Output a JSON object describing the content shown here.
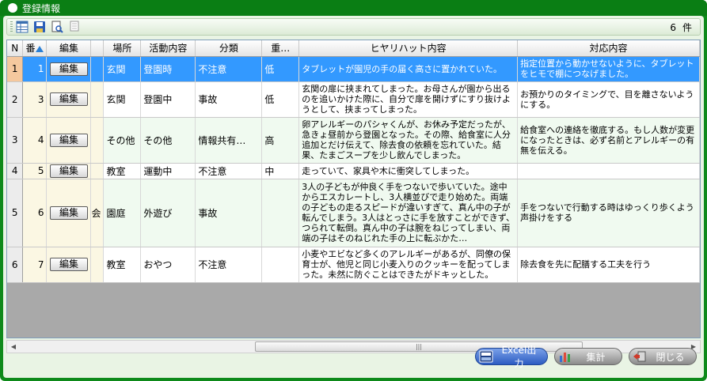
{
  "window": {
    "title": "登録情報"
  },
  "toolbar": {
    "icons": [
      "grid-icon",
      "save-icon",
      "preview-icon",
      "print-icon"
    ],
    "count": "6",
    "count_unit": "件"
  },
  "table": {
    "headers": {
      "rownum": "N",
      "ban": "番",
      "edit": "編集",
      "blank": "",
      "place": "場所",
      "activity": "活動内容",
      "category": "分類",
      "severity": "重…",
      "incident": "ヒヤリハット内容",
      "response": "対応内容"
    },
    "edit_label": "編集",
    "rows": [
      {
        "rownum": "1",
        "ban": "1",
        "extra": "",
        "place": "玄関",
        "activity": "登園時",
        "category": "不注意",
        "severity": "低",
        "incident": "タブレットが園児の手の届く高さに置かれていた。",
        "response": "指定位置から動かせないように、タブレットをヒモで棚につなげました。"
      },
      {
        "rownum": "2",
        "ban": "3",
        "extra": "",
        "place": "玄関",
        "activity": "登園中",
        "category": "事故",
        "severity": "低",
        "incident": "玄関の扉に挟まれてしまった。お母さんが園から出るのを追いかけた際に、自分で扉を開けずにすり抜けようとして、挟まってしまった。",
        "response": "お預かりのタイミングで、目を離さないようにする。"
      },
      {
        "rownum": "3",
        "ban": "4",
        "extra": "",
        "place": "その他",
        "activity": "その他",
        "category": "情報共有…",
        "severity": "高",
        "incident": "卵アレルギーのパシャくんが、お休み予定だったが、急きょ昼前から登園となった。その際、給食室に人分追加とだけ伝えて、除去食の依頼を忘れていた。結果、たまごスープを少し飲んでしまった。",
        "response": "給食室への連絡を徹底する。もし人数が変更になったときは、必ず名前とアレルギーの有無を伝える。"
      },
      {
        "rownum": "4",
        "ban": "5",
        "extra": "",
        "place": "教室",
        "activity": "運動中",
        "category": "不注意",
        "severity": "中",
        "incident": "走っていて、家具や木に衝突してしまった。",
        "response": ""
      },
      {
        "rownum": "5",
        "ban": "6",
        "extra": "会",
        "place": "園庭",
        "activity": "外遊び",
        "category": "事故",
        "severity": "",
        "incident": "3人の子どもが仲良く手をつないで歩いていた。途中からエスカレートし、3人横並びで走り始めた。両端の子どもの走るスピードが違いすぎて、真ん中の子が転んでしまう。3人はとっさに手を放すことができず、つられて転倒。真ん中の子は腕をねじってしまい、両端の子はそのねじれた手の上に転ぶかた…",
        "response": "手をつないで行動する時はゆっくり歩くよう声掛けをする"
      },
      {
        "rownum": "6",
        "ban": "7",
        "extra": "",
        "place": "教室",
        "activity": "おやつ",
        "category": "不注意",
        "severity": "",
        "incident": "小麦やエビなど多くのアレルギーがあるが、同僚の保育士が、他児と同じ小麦入りのクッキーを配ってしまった。未然に防ぐことはできたがドキッとした。",
        "response": "除去食を先に配膳する工夫を行う"
      }
    ]
  },
  "footer": {
    "excel_label": "Excel出力",
    "sum_label": "集計",
    "close_label": "閉じる"
  },
  "colors": {
    "frame": "#0e8a1a",
    "selected_row": "#3399ff",
    "excel_button": "#2c5cc2"
  }
}
